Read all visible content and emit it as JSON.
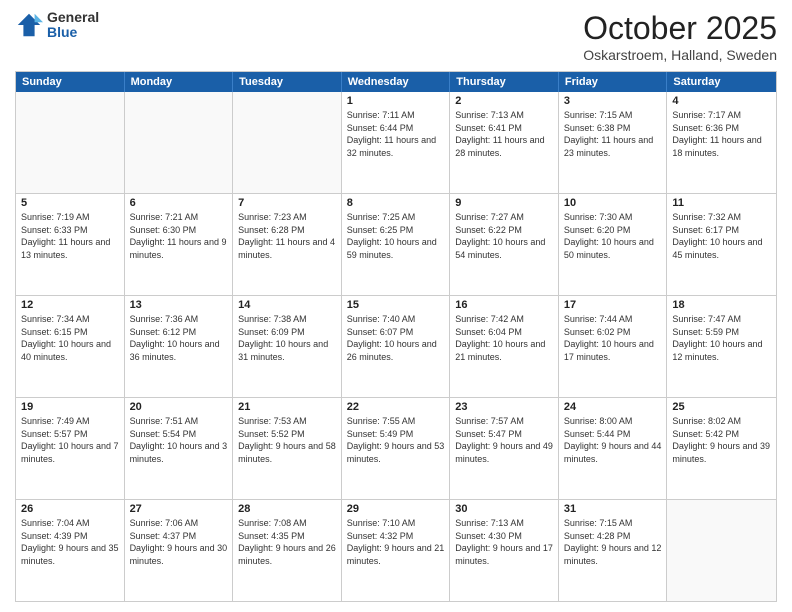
{
  "logo": {
    "general": "General",
    "blue": "Blue"
  },
  "header": {
    "month": "October 2025",
    "location": "Oskarstroem, Halland, Sweden"
  },
  "weekdays": [
    "Sunday",
    "Monday",
    "Tuesday",
    "Wednesday",
    "Thursday",
    "Friday",
    "Saturday"
  ],
  "rows": [
    [
      {
        "day": "",
        "sunrise": "",
        "sunset": "",
        "daylight": ""
      },
      {
        "day": "",
        "sunrise": "",
        "sunset": "",
        "daylight": ""
      },
      {
        "day": "",
        "sunrise": "",
        "sunset": "",
        "daylight": ""
      },
      {
        "day": "1",
        "sunrise": "Sunrise: 7:11 AM",
        "sunset": "Sunset: 6:44 PM",
        "daylight": "Daylight: 11 hours and 32 minutes."
      },
      {
        "day": "2",
        "sunrise": "Sunrise: 7:13 AM",
        "sunset": "Sunset: 6:41 PM",
        "daylight": "Daylight: 11 hours and 28 minutes."
      },
      {
        "day": "3",
        "sunrise": "Sunrise: 7:15 AM",
        "sunset": "Sunset: 6:38 PM",
        "daylight": "Daylight: 11 hours and 23 minutes."
      },
      {
        "day": "4",
        "sunrise": "Sunrise: 7:17 AM",
        "sunset": "Sunset: 6:36 PM",
        "daylight": "Daylight: 11 hours and 18 minutes."
      }
    ],
    [
      {
        "day": "5",
        "sunrise": "Sunrise: 7:19 AM",
        "sunset": "Sunset: 6:33 PM",
        "daylight": "Daylight: 11 hours and 13 minutes."
      },
      {
        "day": "6",
        "sunrise": "Sunrise: 7:21 AM",
        "sunset": "Sunset: 6:30 PM",
        "daylight": "Daylight: 11 hours and 9 minutes."
      },
      {
        "day": "7",
        "sunrise": "Sunrise: 7:23 AM",
        "sunset": "Sunset: 6:28 PM",
        "daylight": "Daylight: 11 hours and 4 minutes."
      },
      {
        "day": "8",
        "sunrise": "Sunrise: 7:25 AM",
        "sunset": "Sunset: 6:25 PM",
        "daylight": "Daylight: 10 hours and 59 minutes."
      },
      {
        "day": "9",
        "sunrise": "Sunrise: 7:27 AM",
        "sunset": "Sunset: 6:22 PM",
        "daylight": "Daylight: 10 hours and 54 minutes."
      },
      {
        "day": "10",
        "sunrise": "Sunrise: 7:30 AM",
        "sunset": "Sunset: 6:20 PM",
        "daylight": "Daylight: 10 hours and 50 minutes."
      },
      {
        "day": "11",
        "sunrise": "Sunrise: 7:32 AM",
        "sunset": "Sunset: 6:17 PM",
        "daylight": "Daylight: 10 hours and 45 minutes."
      }
    ],
    [
      {
        "day": "12",
        "sunrise": "Sunrise: 7:34 AM",
        "sunset": "Sunset: 6:15 PM",
        "daylight": "Daylight: 10 hours and 40 minutes."
      },
      {
        "day": "13",
        "sunrise": "Sunrise: 7:36 AM",
        "sunset": "Sunset: 6:12 PM",
        "daylight": "Daylight: 10 hours and 36 minutes."
      },
      {
        "day": "14",
        "sunrise": "Sunrise: 7:38 AM",
        "sunset": "Sunset: 6:09 PM",
        "daylight": "Daylight: 10 hours and 31 minutes."
      },
      {
        "day": "15",
        "sunrise": "Sunrise: 7:40 AM",
        "sunset": "Sunset: 6:07 PM",
        "daylight": "Daylight: 10 hours and 26 minutes."
      },
      {
        "day": "16",
        "sunrise": "Sunrise: 7:42 AM",
        "sunset": "Sunset: 6:04 PM",
        "daylight": "Daylight: 10 hours and 21 minutes."
      },
      {
        "day": "17",
        "sunrise": "Sunrise: 7:44 AM",
        "sunset": "Sunset: 6:02 PM",
        "daylight": "Daylight: 10 hours and 17 minutes."
      },
      {
        "day": "18",
        "sunrise": "Sunrise: 7:47 AM",
        "sunset": "Sunset: 5:59 PM",
        "daylight": "Daylight: 10 hours and 12 minutes."
      }
    ],
    [
      {
        "day": "19",
        "sunrise": "Sunrise: 7:49 AM",
        "sunset": "Sunset: 5:57 PM",
        "daylight": "Daylight: 10 hours and 7 minutes."
      },
      {
        "day": "20",
        "sunrise": "Sunrise: 7:51 AM",
        "sunset": "Sunset: 5:54 PM",
        "daylight": "Daylight: 10 hours and 3 minutes."
      },
      {
        "day": "21",
        "sunrise": "Sunrise: 7:53 AM",
        "sunset": "Sunset: 5:52 PM",
        "daylight": "Daylight: 9 hours and 58 minutes."
      },
      {
        "day": "22",
        "sunrise": "Sunrise: 7:55 AM",
        "sunset": "Sunset: 5:49 PM",
        "daylight": "Daylight: 9 hours and 53 minutes."
      },
      {
        "day": "23",
        "sunrise": "Sunrise: 7:57 AM",
        "sunset": "Sunset: 5:47 PM",
        "daylight": "Daylight: 9 hours and 49 minutes."
      },
      {
        "day": "24",
        "sunrise": "Sunrise: 8:00 AM",
        "sunset": "Sunset: 5:44 PM",
        "daylight": "Daylight: 9 hours and 44 minutes."
      },
      {
        "day": "25",
        "sunrise": "Sunrise: 8:02 AM",
        "sunset": "Sunset: 5:42 PM",
        "daylight": "Daylight: 9 hours and 39 minutes."
      }
    ],
    [
      {
        "day": "26",
        "sunrise": "Sunrise: 7:04 AM",
        "sunset": "Sunset: 4:39 PM",
        "daylight": "Daylight: 9 hours and 35 minutes."
      },
      {
        "day": "27",
        "sunrise": "Sunrise: 7:06 AM",
        "sunset": "Sunset: 4:37 PM",
        "daylight": "Daylight: 9 hours and 30 minutes."
      },
      {
        "day": "28",
        "sunrise": "Sunrise: 7:08 AM",
        "sunset": "Sunset: 4:35 PM",
        "daylight": "Daylight: 9 hours and 26 minutes."
      },
      {
        "day": "29",
        "sunrise": "Sunrise: 7:10 AM",
        "sunset": "Sunset: 4:32 PM",
        "daylight": "Daylight: 9 hours and 21 minutes."
      },
      {
        "day": "30",
        "sunrise": "Sunrise: 7:13 AM",
        "sunset": "Sunset: 4:30 PM",
        "daylight": "Daylight: 9 hours and 17 minutes."
      },
      {
        "day": "31",
        "sunrise": "Sunrise: 7:15 AM",
        "sunset": "Sunset: 4:28 PM",
        "daylight": "Daylight: 9 hours and 12 minutes."
      },
      {
        "day": "",
        "sunrise": "",
        "sunset": "",
        "daylight": ""
      }
    ]
  ]
}
